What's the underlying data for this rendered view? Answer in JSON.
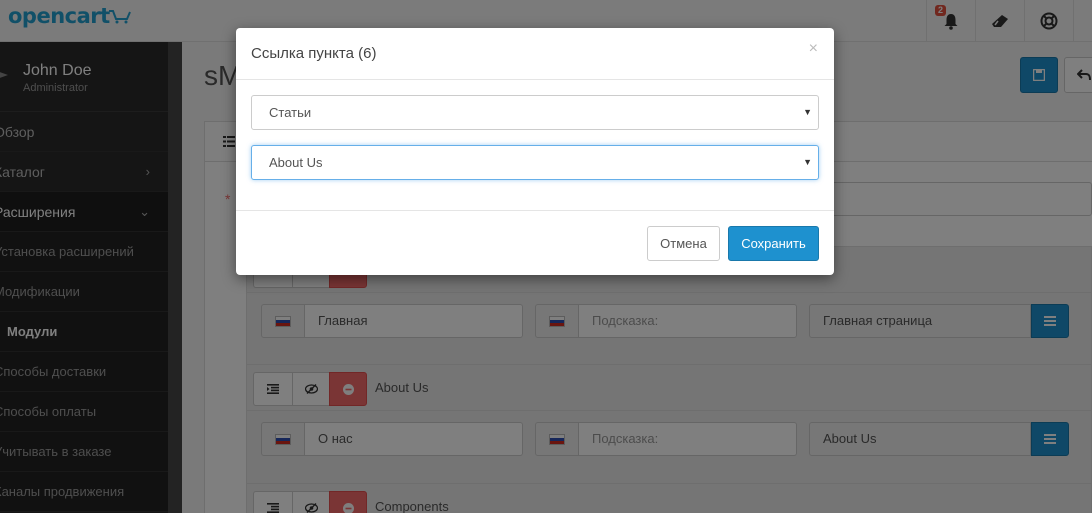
{
  "header": {
    "logo": "opencart",
    "notification_count": "2"
  },
  "sidebar": {
    "user_name": "John Doe",
    "user_role": "Administrator",
    "items": [
      {
        "label": "Обзор"
      },
      {
        "label": "Каталог"
      },
      {
        "label": "Расширения"
      }
    ],
    "sub_items": [
      {
        "label": "Установка расширений"
      },
      {
        "label": "Модификации"
      },
      {
        "label": "Модули"
      },
      {
        "label": "Способы доставки"
      },
      {
        "label": "Способы оплаты"
      },
      {
        "label": "Учитывать в заказе"
      },
      {
        "label": "Каналы продвижения"
      }
    ]
  },
  "main": {
    "page_title": "sM",
    "required_mark": "*",
    "rows": [
      {
        "title": "",
        "name_value": "Главная",
        "hint_placeholder": "Подсказка:",
        "link_value": "Главная страница"
      },
      {
        "title": "About Us",
        "name_value": "О нас",
        "hint_placeholder": "Подсказка:",
        "link_value": "About Us"
      },
      {
        "title": "Components"
      }
    ]
  },
  "modal": {
    "title": "Ссылка пункта (6)",
    "close": "×",
    "select_type": "Статьи",
    "select_item": "About Us",
    "cancel_label": "Отмена",
    "save_label": "Сохранить"
  },
  "colors": {
    "primary": "#1e91cf",
    "danger": "#f56b6b",
    "logo": "#23a1d1",
    "sidebar": "#2a2a2a"
  }
}
